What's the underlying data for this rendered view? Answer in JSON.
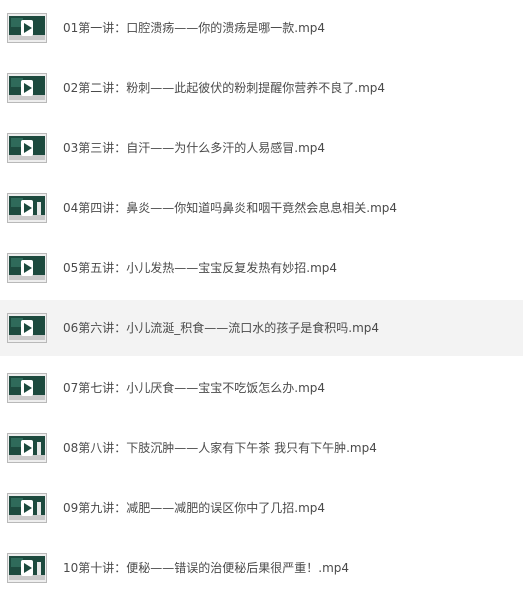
{
  "files": [
    {
      "name": "01第一讲：口腔溃疡——你的溃疡是哪一款.mp4",
      "icon": "video-file-icon"
    },
    {
      "name": "02第二讲：粉刺——此起彼伏的粉刺提醒你营养不良了.mp4",
      "icon": "video-file-icon"
    },
    {
      "name": "03第三讲：自汗——为什么多汗的人易感冒.mp4",
      "icon": "video-file-icon"
    },
    {
      "name": "04第四讲：鼻炎——你知道吗鼻炎和咽干竟然会息息相关.mp4",
      "icon": "video-file-icon"
    },
    {
      "name": "05第五讲：小儿发热——宝宝反复发热有妙招.mp4",
      "icon": "video-file-icon"
    },
    {
      "name": "06第六讲：小儿流涎_积食——流口水的孩子是食积吗.mp4",
      "icon": "video-file-icon",
      "selected": true
    },
    {
      "name": "07第七讲：小儿厌食——宝宝不吃饭怎么办.mp4",
      "icon": "video-file-icon"
    },
    {
      "name": "08第八讲：下肢沉肿——人家有下午茶 我只有下午肿.mp4",
      "icon": "video-file-icon"
    },
    {
      "name": "09第九讲：减肥——减肥的误区你中了几招.mp4",
      "icon": "video-file-icon"
    },
    {
      "name": "10第十讲：便秘——错误的治便秘后果很严重！.mp4",
      "icon": "video-file-icon"
    }
  ],
  "colors": {
    "selected_row_bg": "#f3f3f3",
    "text": "#4a4a4a",
    "thumb_board": "#1d4a3e"
  }
}
